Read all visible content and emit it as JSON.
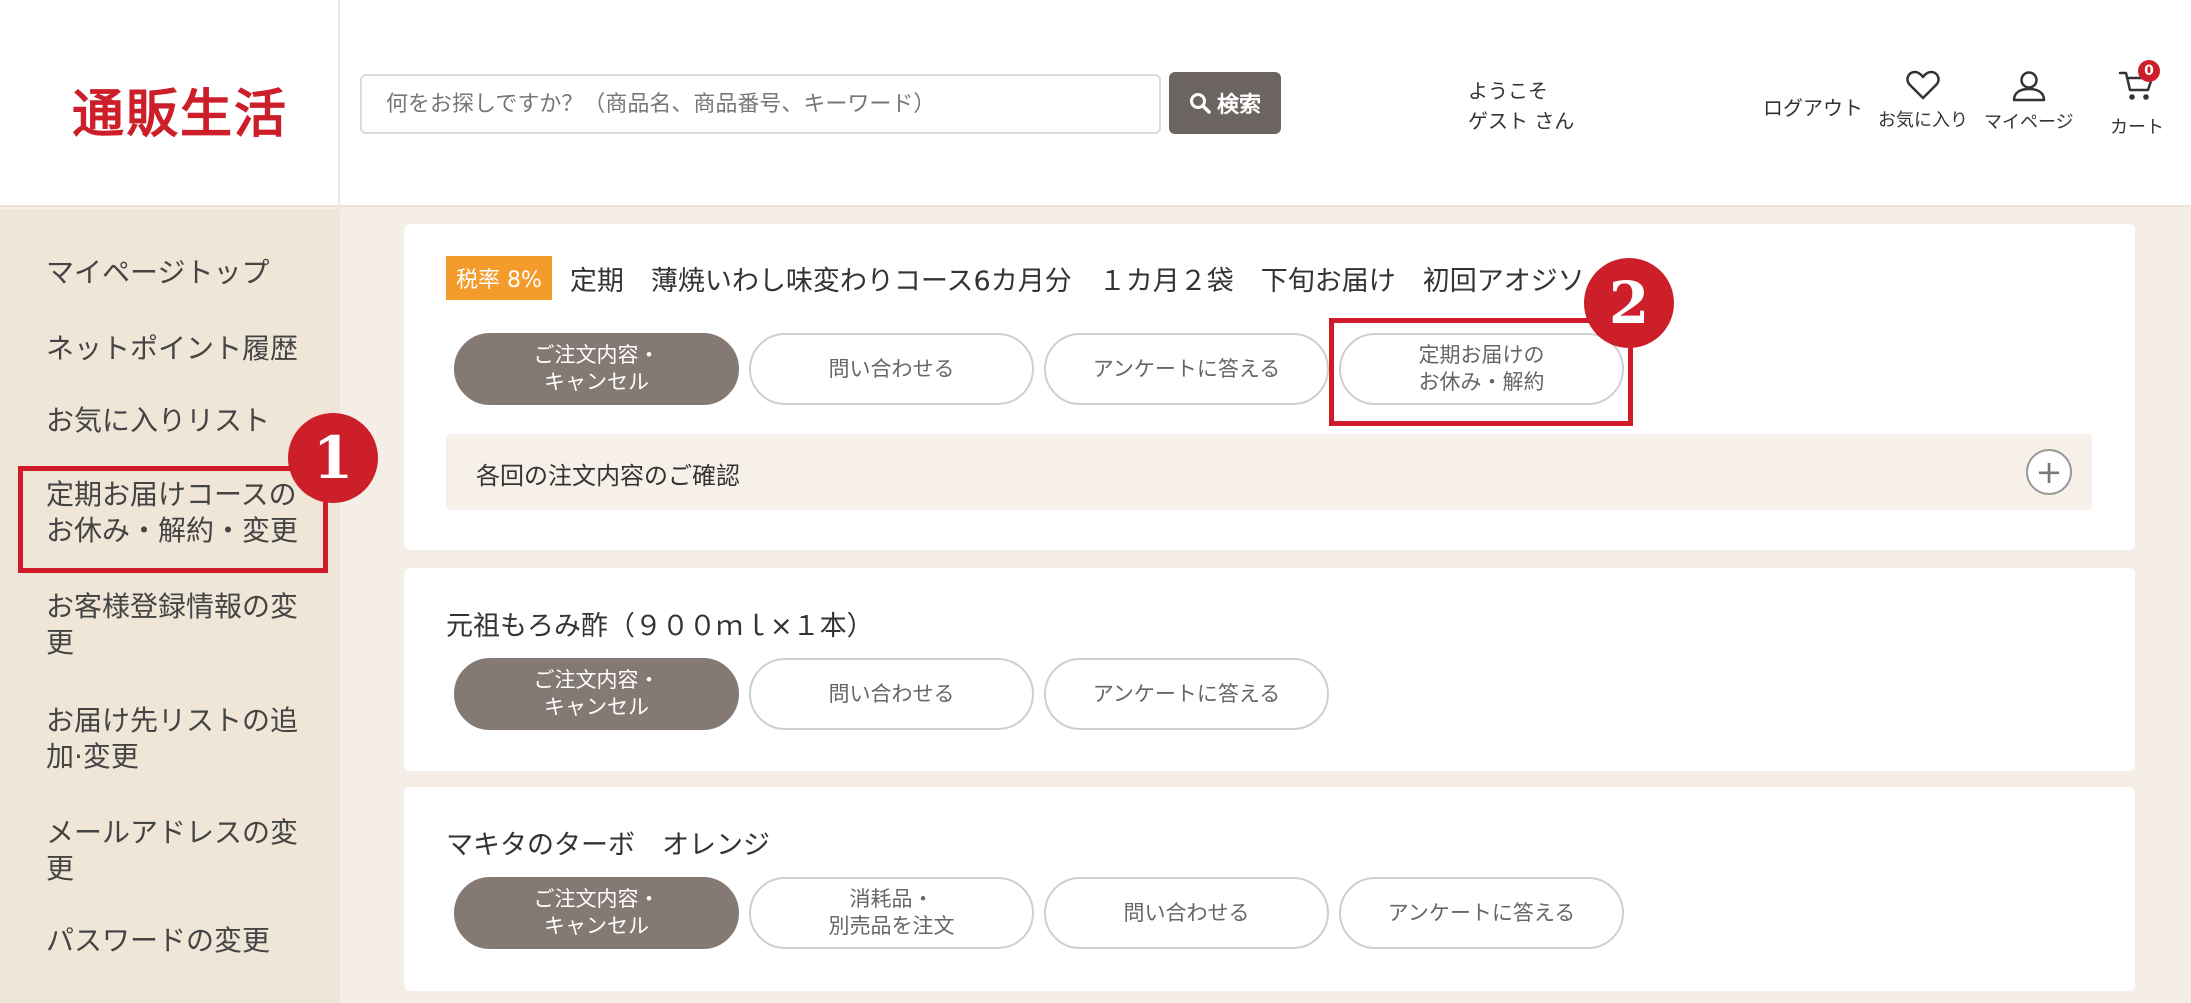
{
  "header": {
    "logo": "通販生活",
    "search_placeholder": "何をお探しですか？（商品名、商品番号、キーワード）",
    "search_button": "検索",
    "welcome_line1": "ようこそ",
    "welcome_line2": "ゲスト さん",
    "logout": "ログアウト",
    "favorites": "お気に入り",
    "mypage": "マイページ",
    "cart": "カート",
    "cart_count": "0"
  },
  "sidebar": {
    "items": [
      "マイページトップ",
      "ネットポイント履歴",
      "お気に入りリスト",
      "定期お届けコースのお休み・解約・変更",
      "お客様登録情報の変更",
      "お届け先リストの追加·変更",
      "メールアドレスの変更",
      "パスワードの変更"
    ]
  },
  "annotations": {
    "badge1": "1",
    "badge2": "2"
  },
  "orders": [
    {
      "tax": "税率 8%",
      "title": "定期　薄焼いわし味変わりコース6カ月分　１カ月２袋　下旬お届け　初回アオジソ",
      "buttons": [
        "ご注文内容・\nキャンセル",
        "問い合わせる",
        "アンケートに答える",
        "定期お届けの\nお休み・解約"
      ],
      "confirm": "各回の注文内容のご確認",
      "plus": "+"
    },
    {
      "title": "元祖もろみ酢（９００ｍｌ×１本）",
      "buttons": [
        "ご注文内容・\nキャンセル",
        "問い合わせる",
        "アンケートに答える"
      ]
    },
    {
      "title": "マキタのターボ　オレンジ",
      "buttons": [
        "ご注文内容・\nキャンセル",
        "消耗品・\n別売品を注文",
        "問い合わせる",
        "アンケートに答える"
      ]
    }
  ],
  "colors": {
    "brand_red": "#cc1f2a",
    "tax_orange": "#f39c2c",
    "dark_pill": "#857a73",
    "sidebar_bg": "#efe6d8"
  }
}
